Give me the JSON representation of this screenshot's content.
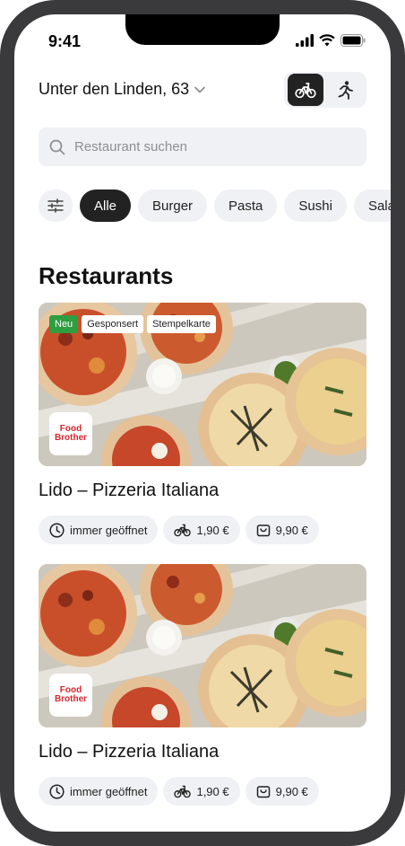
{
  "status_bar": {
    "time": "9:41"
  },
  "header": {
    "address": "Unter den Linden, 63"
  },
  "search": {
    "placeholder": "Restaurant suchen"
  },
  "categories": [
    "Alle",
    "Burger",
    "Pasta",
    "Sushi",
    "Salat"
  ],
  "section_title": "Restaurants",
  "restaurants": [
    {
      "badges": [
        "Neu",
        "Gesponsert",
        "Stempelkarte"
      ],
      "logo_text": [
        "Food",
        "Brother"
      ],
      "name": "Lido – Pizzeria Italiana",
      "opening": "immer geöffnet",
      "delivery_fee": "1,90 €",
      "min_order": "9,90 €"
    },
    {
      "badges": [],
      "logo_text": [
        "Food",
        "Brother"
      ],
      "name": "Lido – Pizzeria Italiana",
      "opening": "immer geöffnet",
      "delivery_fee": "1,90 €",
      "min_order": "9,90 €"
    }
  ],
  "colors": {
    "accent_dark": "#222222",
    "new_badge": "#2e9e3f",
    "brand_logo": "#d7262e",
    "chip_bg": "#f0f1f4"
  }
}
